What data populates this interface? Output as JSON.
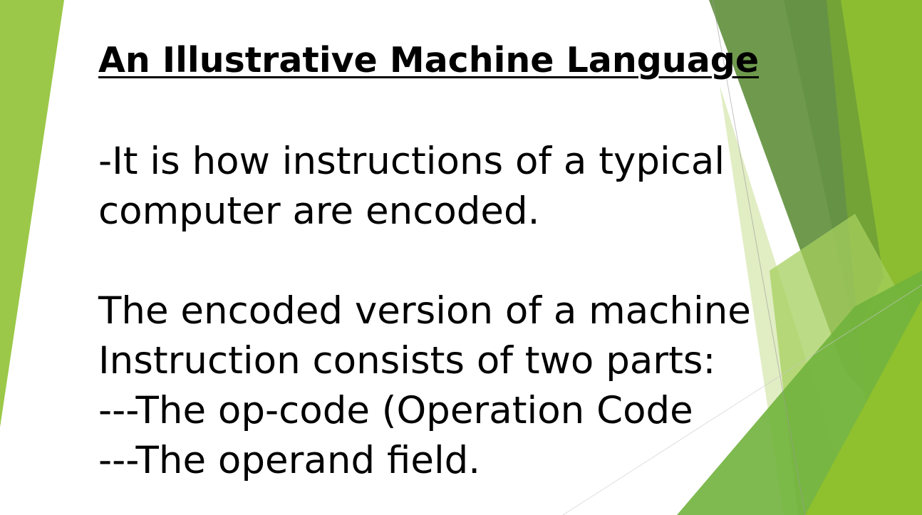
{
  "slide": {
    "title": "An Illustrative Machine Language",
    "paragraph1": [
      "-It is how instructions of a typical",
      "computer are encoded."
    ],
    "paragraph2": [
      "The encoded version of a machine",
      "Instruction consists of two parts:",
      "---The op-code  (Operation Code",
      "---The operand field."
    ]
  },
  "colors": {
    "background": "#ffffff",
    "accent_light": "#9bc848",
    "accent_dark": "#6f9a4e",
    "accent_bright": "#8fc02d",
    "accent_pale": "#dceab8"
  }
}
